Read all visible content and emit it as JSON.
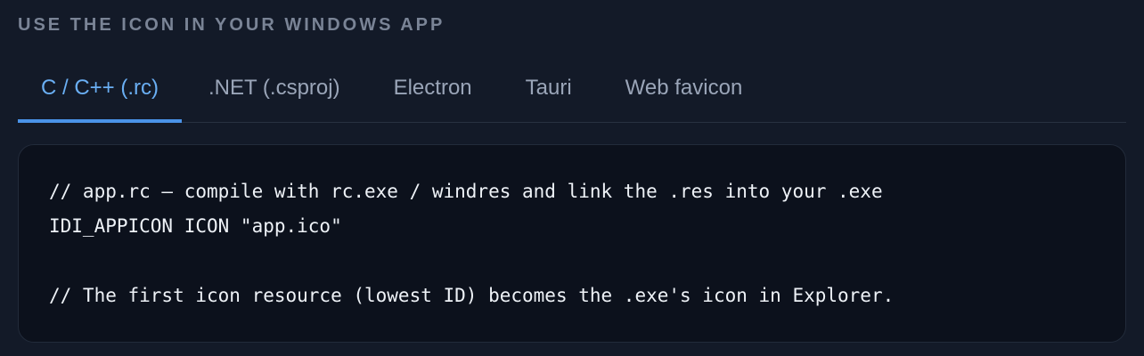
{
  "section": {
    "title": "USE THE ICON IN YOUR WINDOWS APP"
  },
  "tabs": [
    {
      "label": "C / C++ (.rc)",
      "active": true
    },
    {
      "label": ".NET (.csproj)",
      "active": false
    },
    {
      "label": "Electron",
      "active": false
    },
    {
      "label": "Tauri",
      "active": false
    },
    {
      "label": "Web favicon",
      "active": false
    }
  ],
  "code": {
    "lines": [
      "// app.rc — compile with rc.exe / windres and link the .res into your .exe",
      "IDI_APPICON ICON \"app.ico\"",
      "",
      "// The first icon resource (lowest ID) becomes the .exe's icon in Explorer."
    ]
  },
  "colors": {
    "background": "#131a28",
    "panel": "#0c111c",
    "accent": "#4a93e8",
    "active_tab_text": "#6aaff4",
    "tab_text": "#9aa5b8",
    "title_text": "#7a8496"
  }
}
